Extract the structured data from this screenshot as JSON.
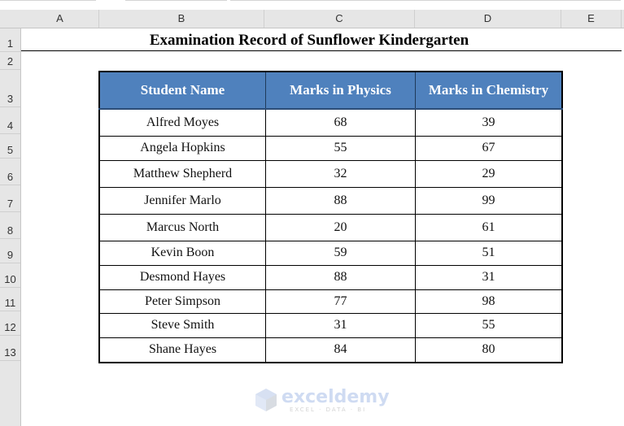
{
  "spreadsheet": {
    "columns": [
      "A",
      "B",
      "C",
      "D",
      "E"
    ],
    "rows": [
      "1",
      "2",
      "3",
      "4",
      "5",
      "6",
      "7",
      "8",
      "9",
      "10",
      "11",
      "12",
      "13"
    ]
  },
  "title": "Examination Record of Sunflower Kindergarten",
  "table": {
    "headers": [
      "Student Name",
      "Marks in Physics",
      "Marks in Chemistry"
    ],
    "rows": [
      {
        "name": "Alfred Moyes",
        "physics": "68",
        "chemistry": "39"
      },
      {
        "name": "Angela Hopkins",
        "physics": "55",
        "chemistry": "67"
      },
      {
        "name": "Matthew Shepherd",
        "physics": "32",
        "chemistry": "29"
      },
      {
        "name": "Jennifer Marlo",
        "physics": "88",
        "chemistry": "99"
      },
      {
        "name": "Marcus North",
        "physics": "20",
        "chemistry": "61"
      },
      {
        "name": "Kevin Boon",
        "physics": "59",
        "chemistry": "51"
      },
      {
        "name": "Desmond Hayes",
        "physics": "88",
        "chemistry": "31"
      },
      {
        "name": "Peter Simpson",
        "physics": "77",
        "chemistry": "98"
      },
      {
        "name": "Steve Smith",
        "physics": "31",
        "chemistry": "55"
      },
      {
        "name": "Shane Hayes",
        "physics": "84",
        "chemistry": "80"
      }
    ]
  },
  "watermark": {
    "brand": "exceldemy",
    "tagline": "EXCEL · DATA · BI"
  },
  "colors": {
    "header_fill": "#4f81bd",
    "header_text": "#ffffff"
  }
}
